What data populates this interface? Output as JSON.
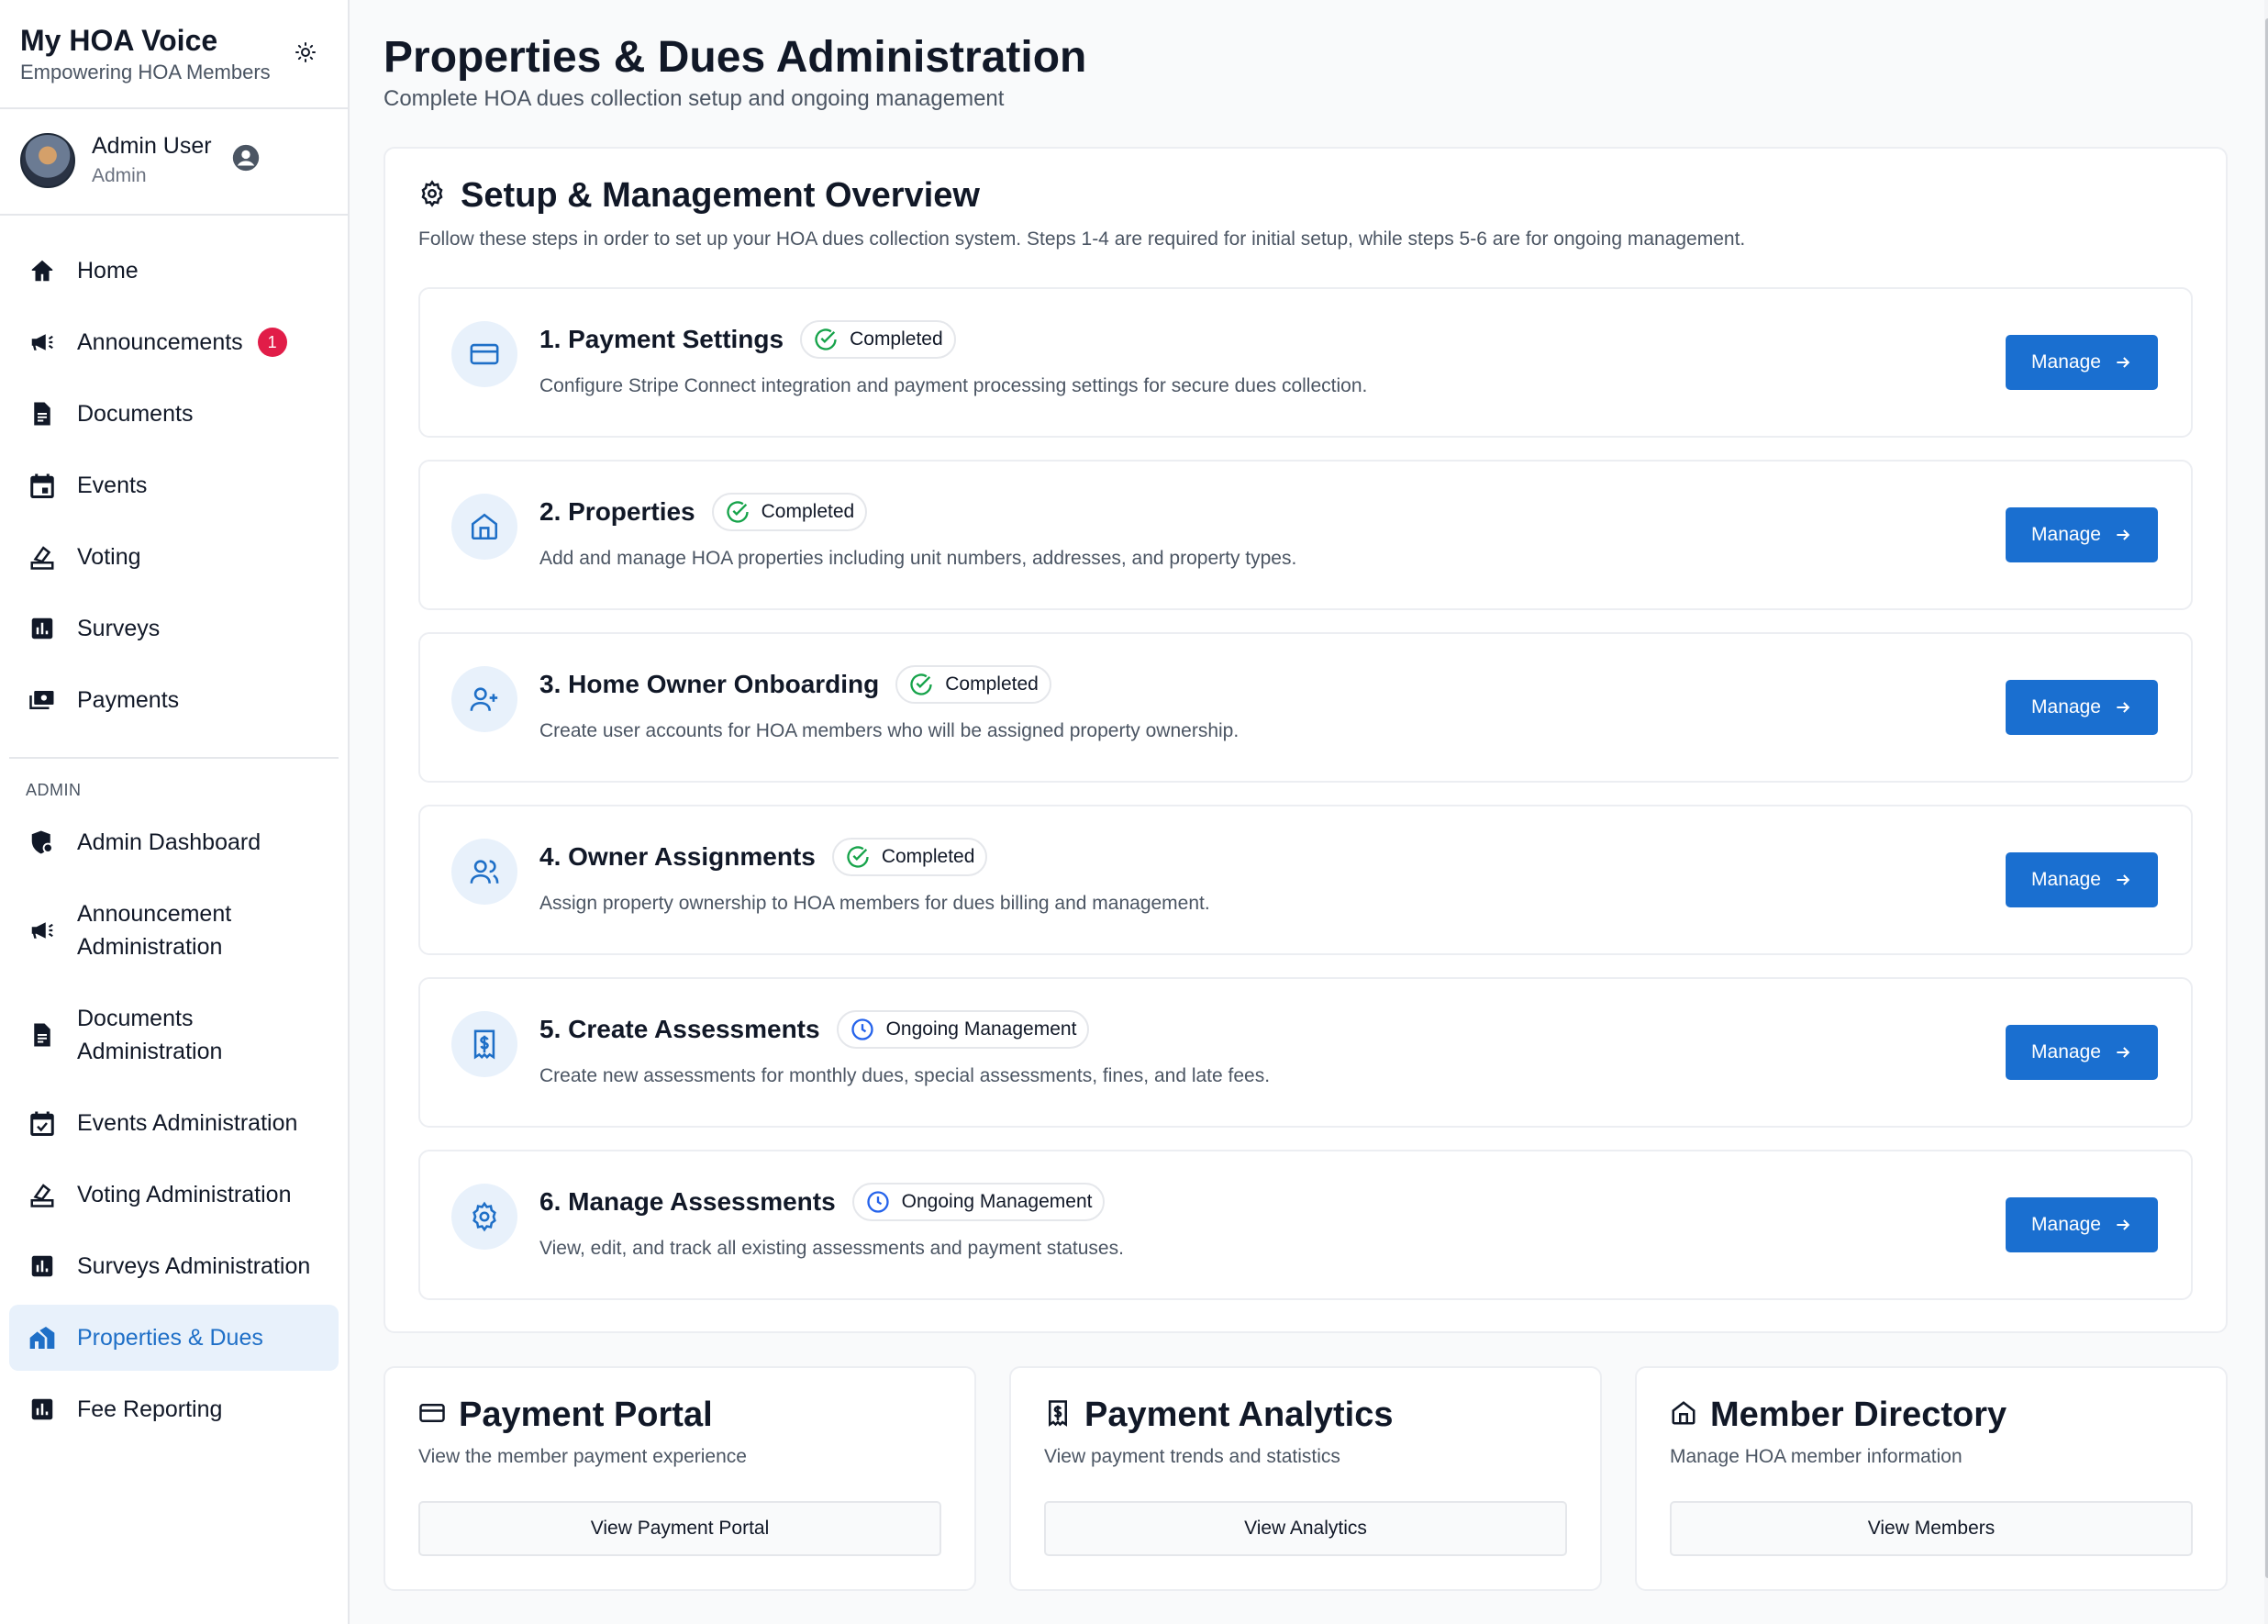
{
  "brand": {
    "title": "My HOA Voice",
    "subtitle": "Empowering HOA Members"
  },
  "user": {
    "name": "Admin User",
    "role": "Admin"
  },
  "nav": {
    "home": "Home",
    "announcements": "Announcements",
    "announcements_badge": "1",
    "documents": "Documents",
    "events": "Events",
    "voting": "Voting",
    "surveys": "Surveys",
    "payments": "Payments",
    "admin_heading": "ADMIN",
    "admin_dashboard": "Admin Dashboard",
    "announcement_admin_1": "Announcement",
    "announcement_admin_2": "Administration",
    "documents_admin_1": "Documents",
    "documents_admin_2": "Administration",
    "events_admin": "Events Administration",
    "voting_admin": "Voting Administration",
    "surveys_admin": "Surveys Administration",
    "properties_dues": "Properties & Dues",
    "fee_reporting": "Fee Reporting"
  },
  "page": {
    "title": "Properties & Dues Administration",
    "subtitle": "Complete HOA dues collection setup and ongoing management"
  },
  "overview": {
    "title": "Setup & Management Overview",
    "description": "Follow these steps in order to set up your HOA dues collection system. Steps 1-4 are required for initial setup, while steps 5-6 are for ongoing management.",
    "manage_label": "Manage",
    "steps": [
      {
        "title": "1. Payment Settings",
        "status": "Completed",
        "description": "Configure Stripe Connect integration and payment processing settings for secure dues collection."
      },
      {
        "title": "2. Properties",
        "status": "Completed",
        "description": "Add and manage HOA properties including unit numbers, addresses, and property types."
      },
      {
        "title": "3. Home Owner Onboarding",
        "status": "Completed",
        "description": "Create user accounts for HOA members who will be assigned property ownership."
      },
      {
        "title": "4. Owner Assignments",
        "status": "Completed",
        "description": "Assign property ownership to HOA members for dues billing and management."
      },
      {
        "title": "5. Create Assessments",
        "status": "Ongoing Management",
        "description": "Create new assessments for monthly dues, special assessments, fines, and late fees."
      },
      {
        "title": "6. Manage Assessments",
        "status": "Ongoing Management",
        "description": "View, edit, and track all existing assessments and payment statuses."
      }
    ]
  },
  "cards": {
    "portal": {
      "title": "Payment Portal",
      "subtitle": "View the member payment experience",
      "button": "View Payment Portal"
    },
    "analytics": {
      "title": "Payment Analytics",
      "subtitle": "View payment trends and statistics",
      "button": "View Analytics"
    },
    "directory": {
      "title": "Member Directory",
      "subtitle": "Manage HOA member information",
      "button": "View Members"
    }
  },
  "colors": {
    "accent": "#1a6fd0",
    "completed": "#16a34a",
    "ongoing": "#2563eb",
    "badge": "#e11d48",
    "active_bg": "#e8f1fb"
  }
}
